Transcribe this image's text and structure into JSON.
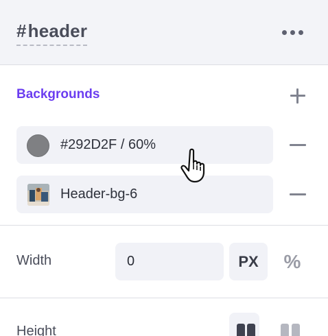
{
  "header": {
    "selector_hash": "#",
    "selector_name": "header",
    "more_icon": "more-horizontal-icon"
  },
  "backgrounds": {
    "title": "Backgrounds",
    "add_icon": "plus-icon",
    "items": [
      {
        "label": "#292D2F / 60%",
        "kind": "color",
        "color": "#292D2F",
        "opacity_percent": 60,
        "remove_icon": "minus-icon"
      },
      {
        "label": "Header-bg-6",
        "kind": "image",
        "remove_icon": "minus-icon"
      }
    ]
  },
  "width": {
    "label": "Width",
    "value": "0",
    "unit_px": "PX",
    "unit_percent": "%",
    "selected_unit": "PX"
  },
  "height": {
    "label": "Height",
    "mode_icons": [
      "height-mode-auto-icon",
      "height-mode-fixed-icon"
    ],
    "selected_mode": 0
  },
  "cursor": "hand-pointer-icon",
  "colors": {
    "accent": "#6B3DF0",
    "panel_bg": "#F3F4F8",
    "field_bg": "#F1F2F7",
    "text": "#2A2D36"
  }
}
